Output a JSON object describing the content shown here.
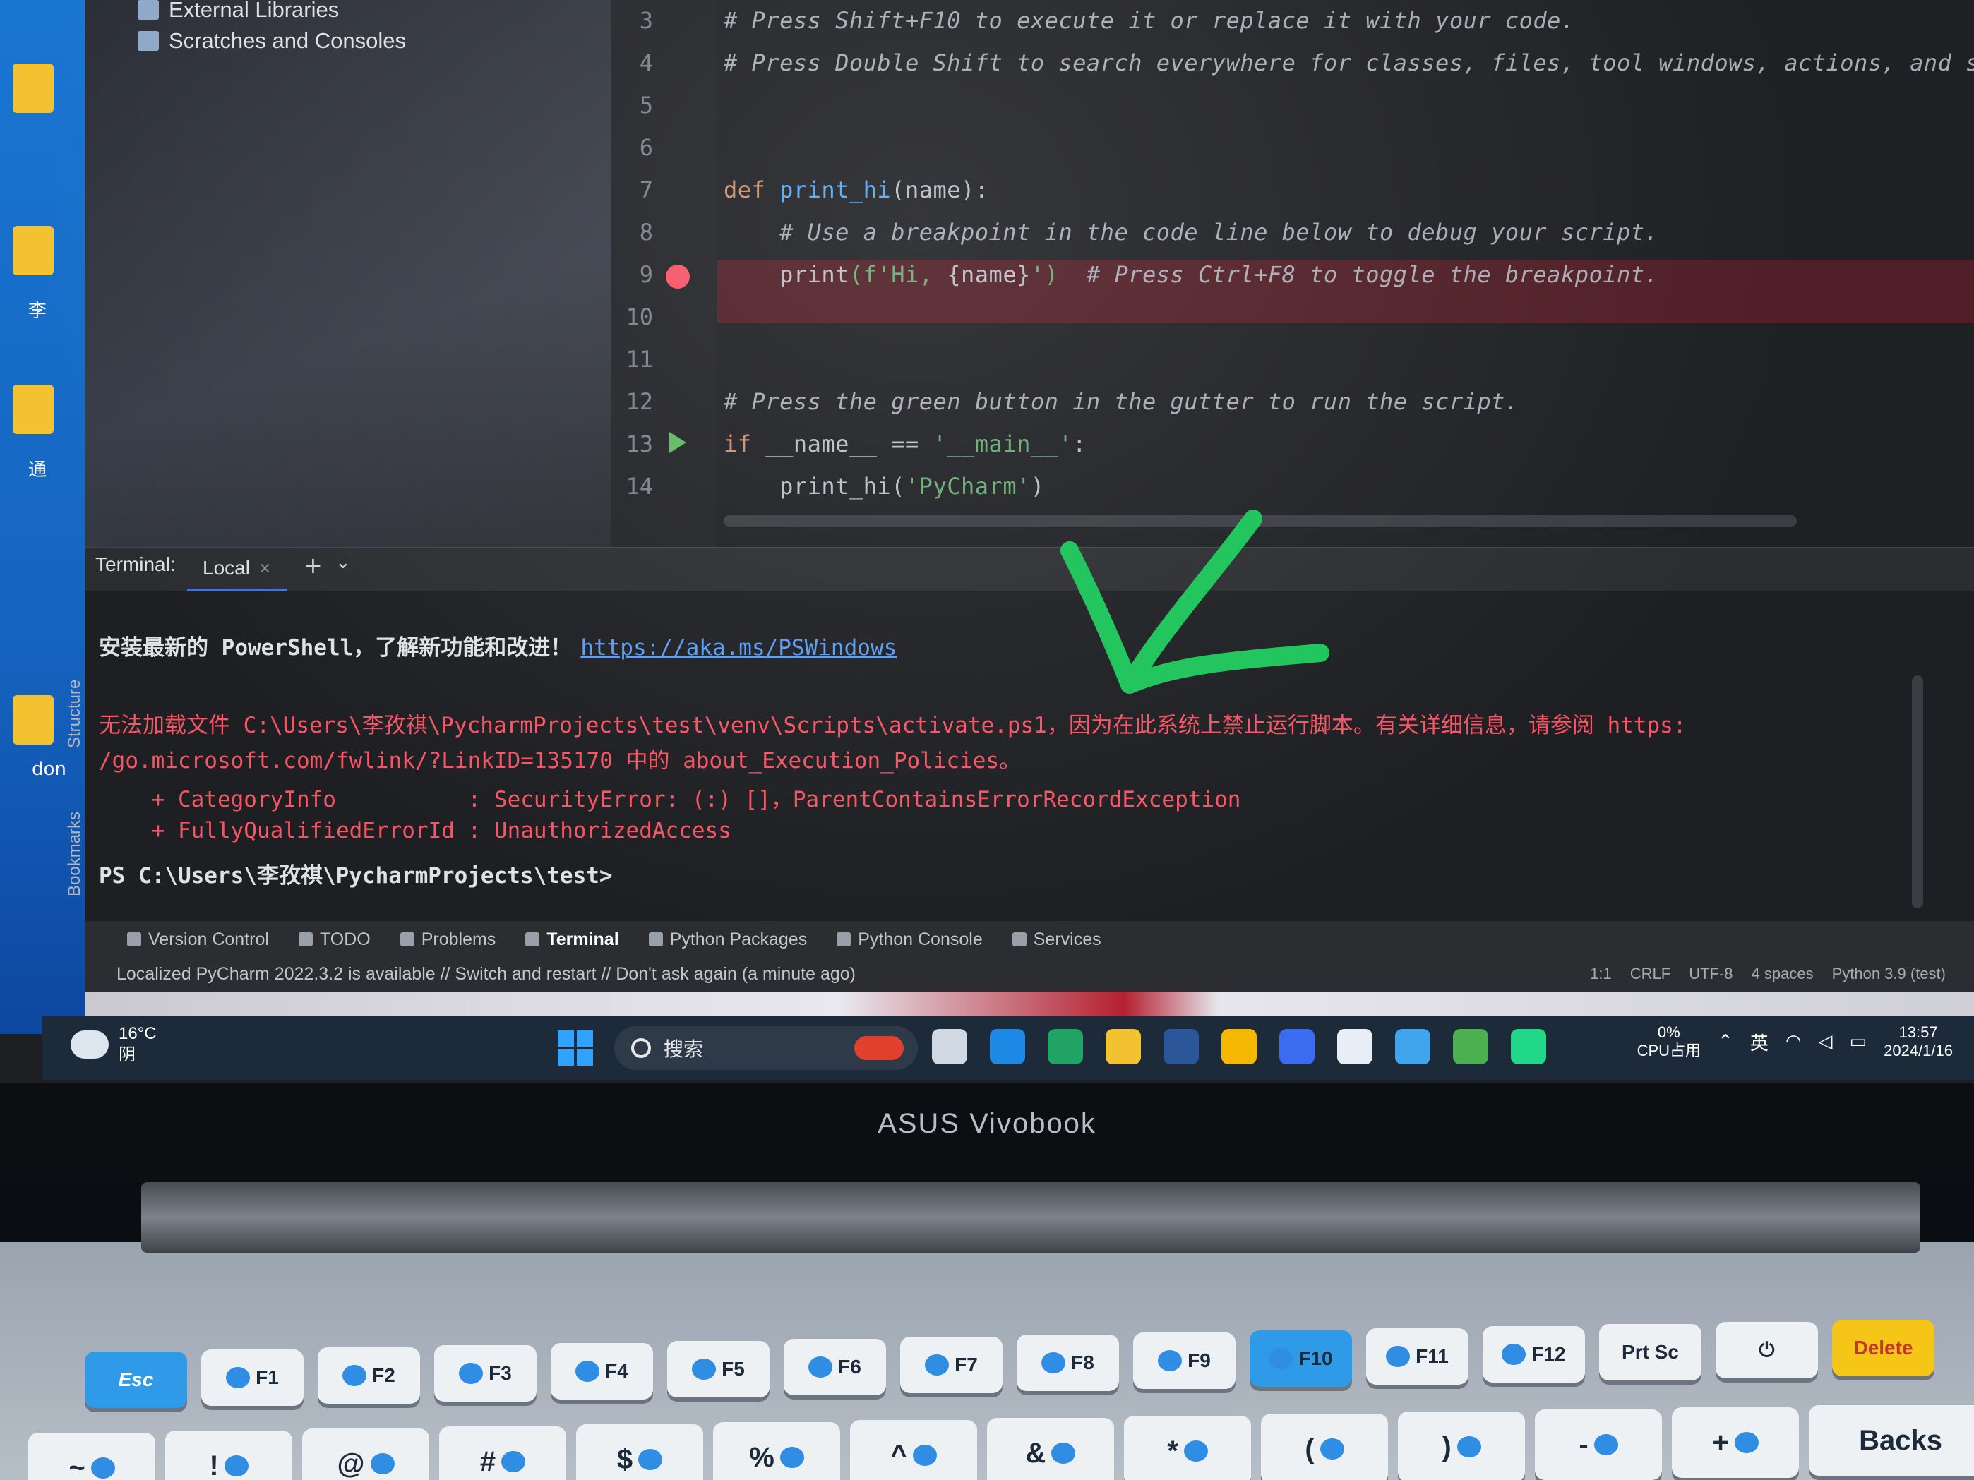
{
  "project_tree": {
    "items": [
      {
        "label": "External Libraries",
        "icon": "library-icon"
      },
      {
        "label": "Scratches and Consoles",
        "icon": "scratches-icon"
      }
    ]
  },
  "desktop_labels": [
    "李",
    "通",
    "don"
  ],
  "editor": {
    "lines": [
      {
        "no": "3",
        "tokens": [
          {
            "t": "# Press Shift+F10 to execute it or replace it with your code.",
            "c": "comment"
          }
        ]
      },
      {
        "no": "4",
        "tokens": [
          {
            "t": "# Press Double Shift to search everywhere for classes, files, tool windows, actions, and setti",
            "c": "comment"
          }
        ]
      },
      {
        "no": "5",
        "tokens": []
      },
      {
        "no": "6",
        "tokens": []
      },
      {
        "no": "7",
        "tokens": [
          {
            "t": "def ",
            "c": "kw"
          },
          {
            "t": "print_hi",
            "c": "fn"
          },
          {
            "t": "(name):",
            "c": "plain"
          }
        ]
      },
      {
        "no": "8",
        "tokens": [
          {
            "t": "    # Use a breakpoint in the code line below to debug your script.",
            "c": "comment"
          }
        ]
      },
      {
        "no": "9",
        "tokens": [
          {
            "t": "    print",
            "c": "plain"
          },
          {
            "t": "(f'Hi, ",
            "c": "str"
          },
          {
            "t": "{name}",
            "c": "plain"
          },
          {
            "t": "')  ",
            "c": "str"
          },
          {
            "t": "# Press Ctrl+F8 to toggle the breakpoint.",
            "c": "comment"
          }
        ]
      },
      {
        "no": "10",
        "tokens": []
      },
      {
        "no": "11",
        "tokens": []
      },
      {
        "no": "12",
        "tokens": [
          {
            "t": "# Press the green button in the gutter to run the script.",
            "c": "comment"
          }
        ]
      },
      {
        "no": "13",
        "tokens": [
          {
            "t": "if ",
            "c": "kw"
          },
          {
            "t": "__name__ == ",
            "c": "plain"
          },
          {
            "t": "'__main__'",
            "c": "str"
          },
          {
            "t": ":",
            "c": "plain"
          }
        ]
      },
      {
        "no": "14",
        "tokens": [
          {
            "t": "    print_hi(",
            "c": "plain"
          },
          {
            "t": "'PyCharm'",
            "c": "str"
          },
          {
            "t": ")",
            "c": "plain"
          }
        ]
      }
    ]
  },
  "terminal": {
    "title": "Terminal:",
    "tab_label": "Local",
    "side_tabs": [
      "Structure",
      "Bookmarks"
    ],
    "lines": [
      {
        "parts": [
          {
            "t": "安装最新的 PowerShell，了解新功能和改进！",
            "c": "white"
          },
          {
            "t": "https://aka.ms/PSWindows",
            "c": "link"
          }
        ]
      },
      {
        "parts": [
          {
            "t": "无法加载文件 C:\\Users\\李孜祺\\PycharmProjects\\test\\venv\\Scripts\\activate.ps1，因为在此系统上禁止运行脚本。有关详细信息，请参阅 https:",
            "c": "red"
          }
        ]
      },
      {
        "parts": [
          {
            "t": "/go.microsoft.com/fwlink/?LinkID=135170 中的 about_Execution_Policies。",
            "c": "red"
          }
        ]
      },
      {
        "parts": [
          {
            "t": "    + CategoryInfo          : SecurityError: (:) []，ParentContainsErrorRecordException",
            "c": "red"
          }
        ]
      },
      {
        "parts": [
          {
            "t": "    + FullyQualifiedErrorId : UnauthorizedAccess",
            "c": "red"
          }
        ]
      },
      {
        "parts": [
          {
            "t": "PS C:\\Users\\李孜祺\\PycharmProjects\\test>",
            "c": "white"
          }
        ]
      }
    ]
  },
  "tool_windows": [
    {
      "label": "Version Control",
      "active": false
    },
    {
      "label": "TODO",
      "active": false
    },
    {
      "label": "Problems",
      "active": false
    },
    {
      "label": "Terminal",
      "active": true
    },
    {
      "label": "Python Packages",
      "active": false
    },
    {
      "label": "Python Console",
      "active": false
    },
    {
      "label": "Services",
      "active": false
    }
  ],
  "status_bar": {
    "message": "Localized PyCharm 2022.3.2 is available // Switch and restart // Don't ask again (a minute ago)",
    "position": "1:1",
    "line_sep": "CRLF",
    "encoding": "UTF-8",
    "indent": "4 spaces",
    "interpreter": "Python 3.9 (test)"
  },
  "taskbar": {
    "weather_temp": "16°C",
    "weather_cond": "阴",
    "search_placeholder": "搜索",
    "app_colors": [
      "#cfd8e3",
      "#1e88e5",
      "#21a366",
      "#f2c230",
      "#2b579a",
      "#f5b800",
      "#3b6cf0",
      "#e8eef5",
      "#41a5ee",
      "#4caf50",
      "#21d789"
    ],
    "cpu_value": "0%",
    "cpu_label": "CPU占用",
    "ime": "英",
    "time": "13:57",
    "date": "2024/1/16"
  },
  "laptop_brand": "ASUS Vivobook",
  "keyboard": {
    "row1": [
      "Esc",
      "F1",
      "F2",
      "F3",
      "F4",
      "F5",
      "F6",
      "F7",
      "F8",
      "F9",
      "F10",
      "F11",
      "F12",
      "Prt Sc",
      "⏻",
      "Delete"
    ],
    "row2": [
      "~",
      "!",
      "@",
      "#",
      "$",
      "%",
      "^",
      "&",
      "*",
      "(",
      ")",
      "-",
      "+",
      "Backs"
    ]
  },
  "colors": {
    "editor_bg": "#1f2024",
    "terminal_error": "#f75464",
    "link": "#5a9cf5",
    "annotation_check": "#22c55e"
  }
}
